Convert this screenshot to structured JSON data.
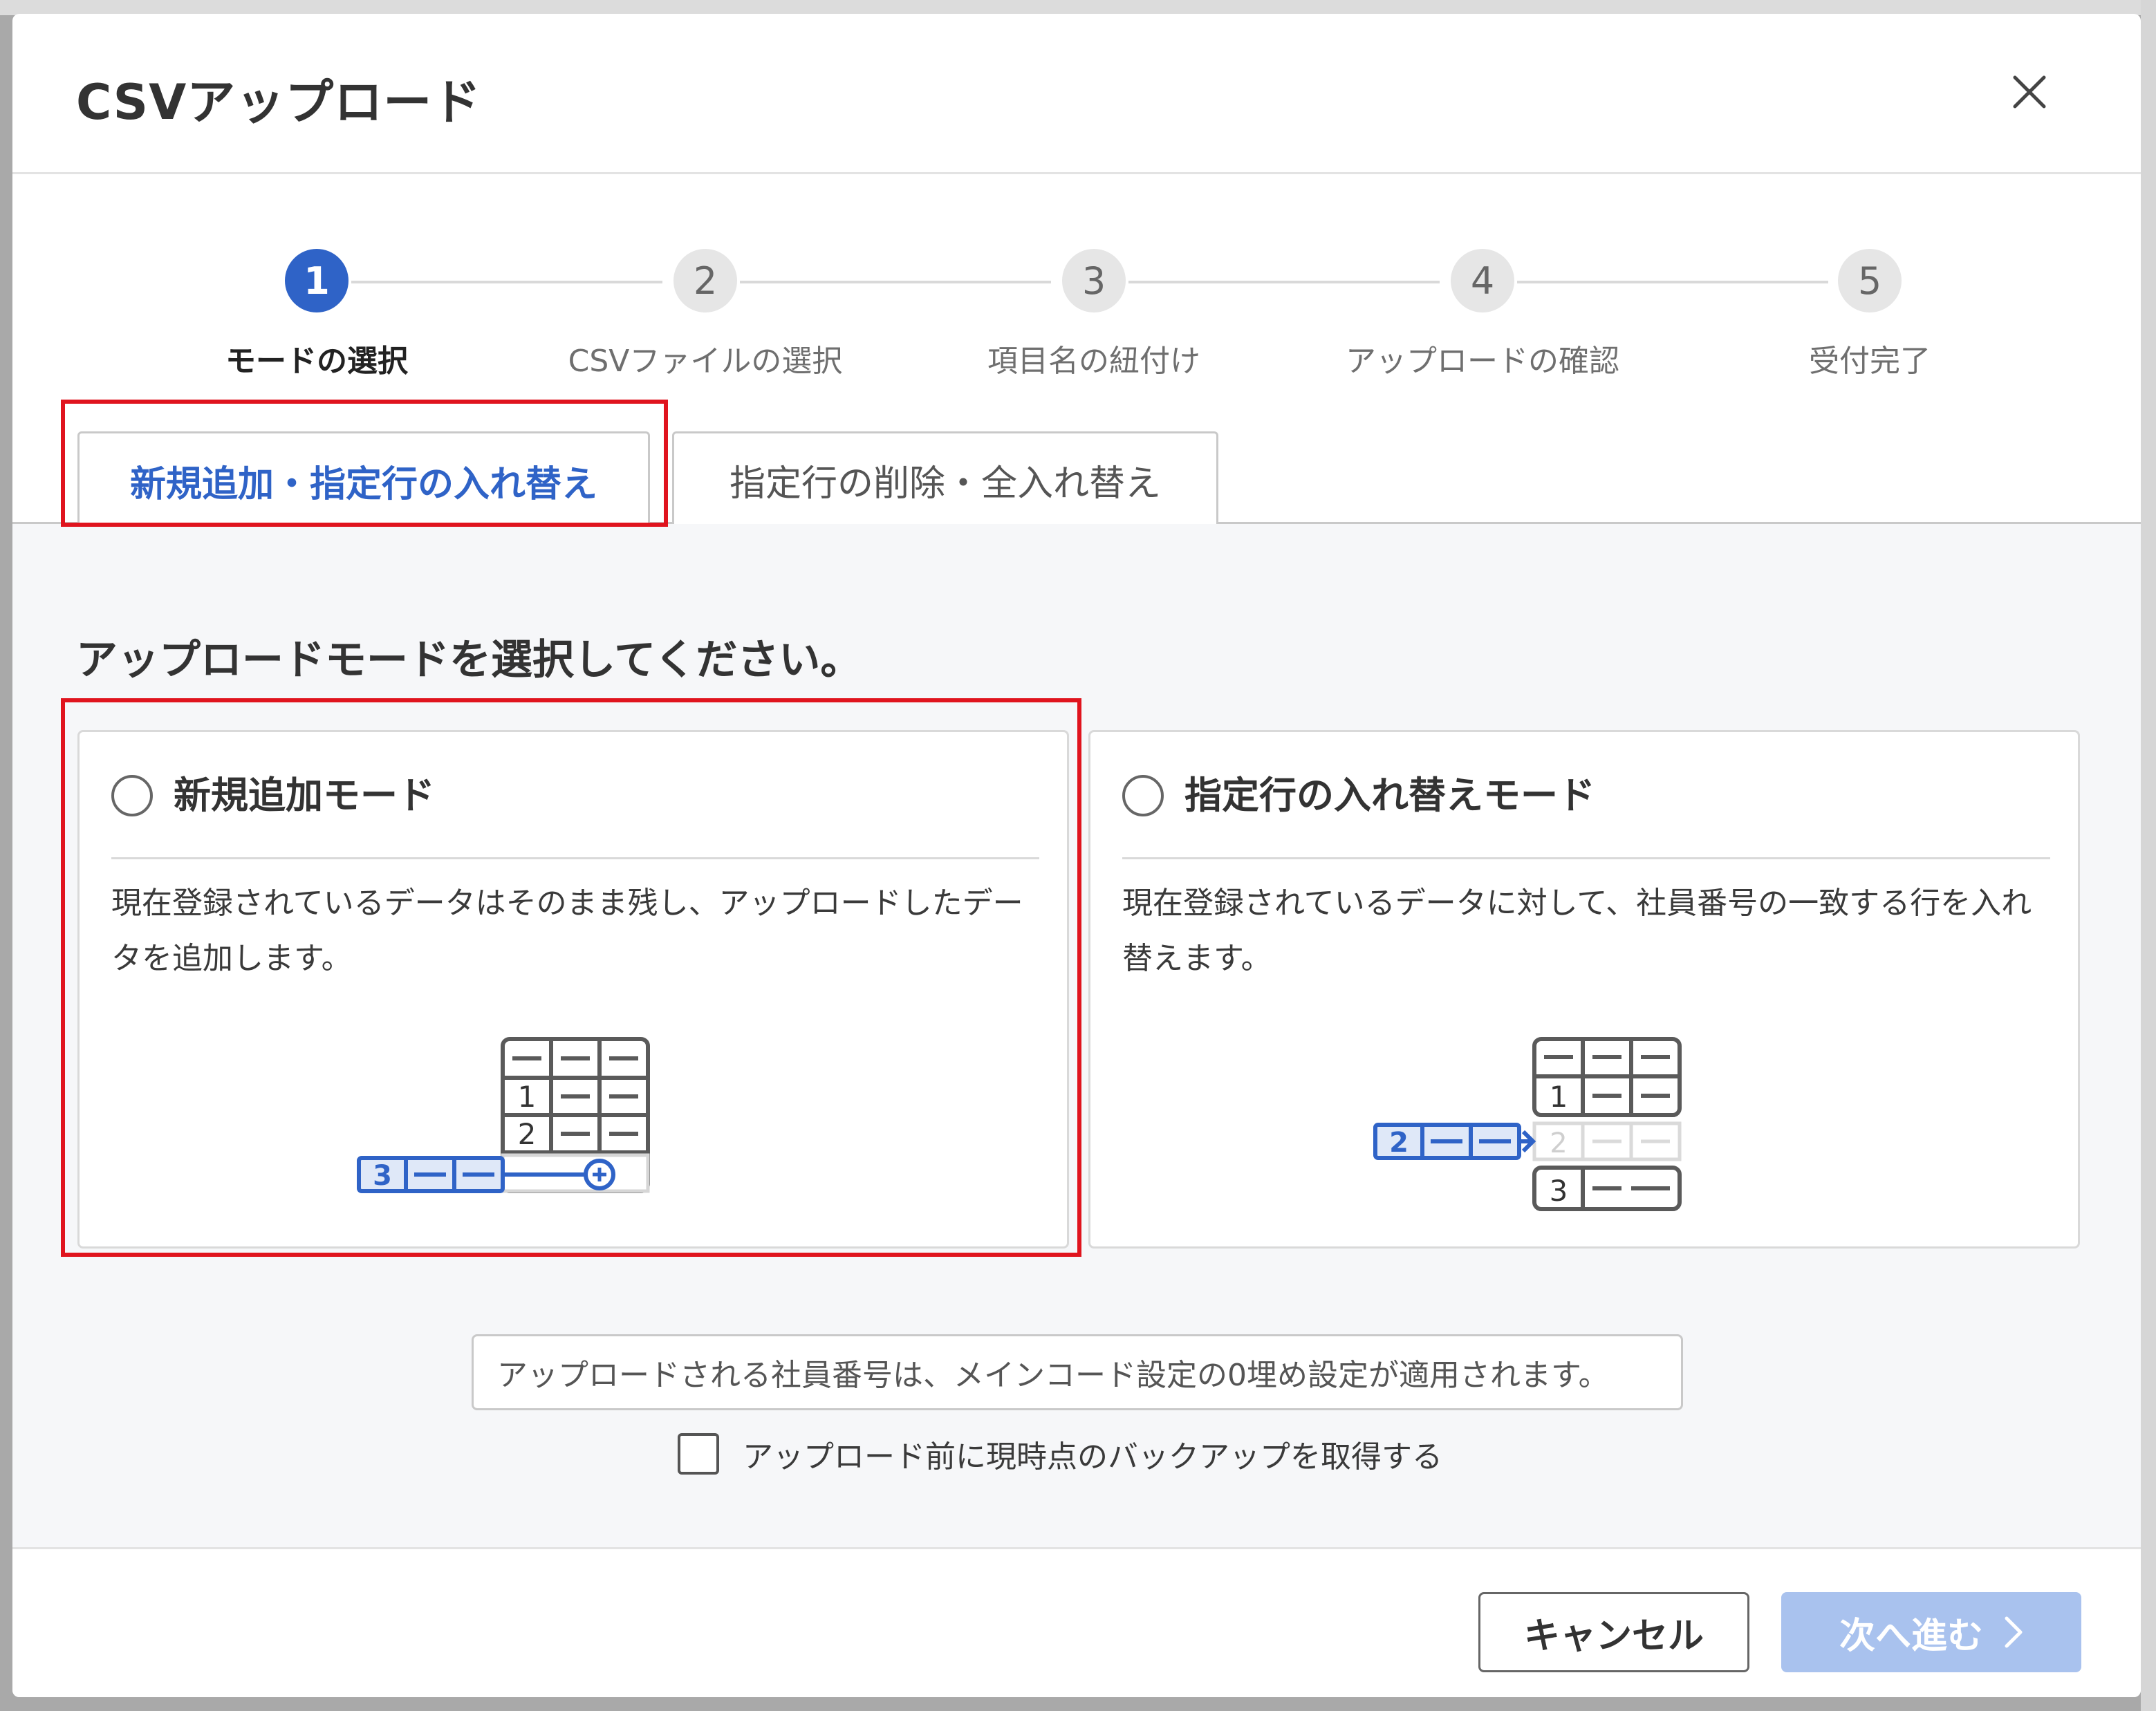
{
  "modal": {
    "title": "CSVアップロード"
  },
  "stepper": {
    "steps": [
      {
        "number": "1",
        "label": "モードの選択"
      },
      {
        "number": "2",
        "label": "CSVファイルの選択"
      },
      {
        "number": "3",
        "label": "項目名の紐付け"
      },
      {
        "number": "4",
        "label": "アップロードの確認"
      },
      {
        "number": "5",
        "label": "受付完了"
      }
    ],
    "active_step": 1
  },
  "tabs": [
    {
      "label": "新規追加・指定行の入れ替え",
      "active": true
    },
    {
      "label": "指定行の削除・全入れ替え",
      "active": false
    }
  ],
  "content": {
    "section_title": "アップロードモードを選択してください。",
    "modes": [
      {
        "title": "新規追加モード",
        "description": "現在登録されているデータはそのまま残し、アップロードしたデータを追加します。",
        "selected": false,
        "illustration": {
          "rows": [
            "1",
            "2"
          ],
          "incoming": "3"
        }
      },
      {
        "title": "指定行の入れ替えモード",
        "description": "現在登録されているデータに対して、社員番号の一致する行を入れ替えます。",
        "selected": false,
        "illustration": {
          "rows": [
            "1",
            "2",
            "3"
          ],
          "incoming": "2"
        }
      }
    ],
    "note": "アップロードされる社員番号は、メインコード設定の0埋め設定が適用されます。",
    "backup_checkbox": {
      "label": "アップロード前に現時点のバックアップを取得する",
      "checked": false
    }
  },
  "footer": {
    "cancel_label": "キャンセル",
    "next_label": "次へ進む"
  },
  "colors": {
    "accent": "#2f63c7",
    "next_disabled": "#a9c2ee",
    "highlight": "#e0141e"
  }
}
